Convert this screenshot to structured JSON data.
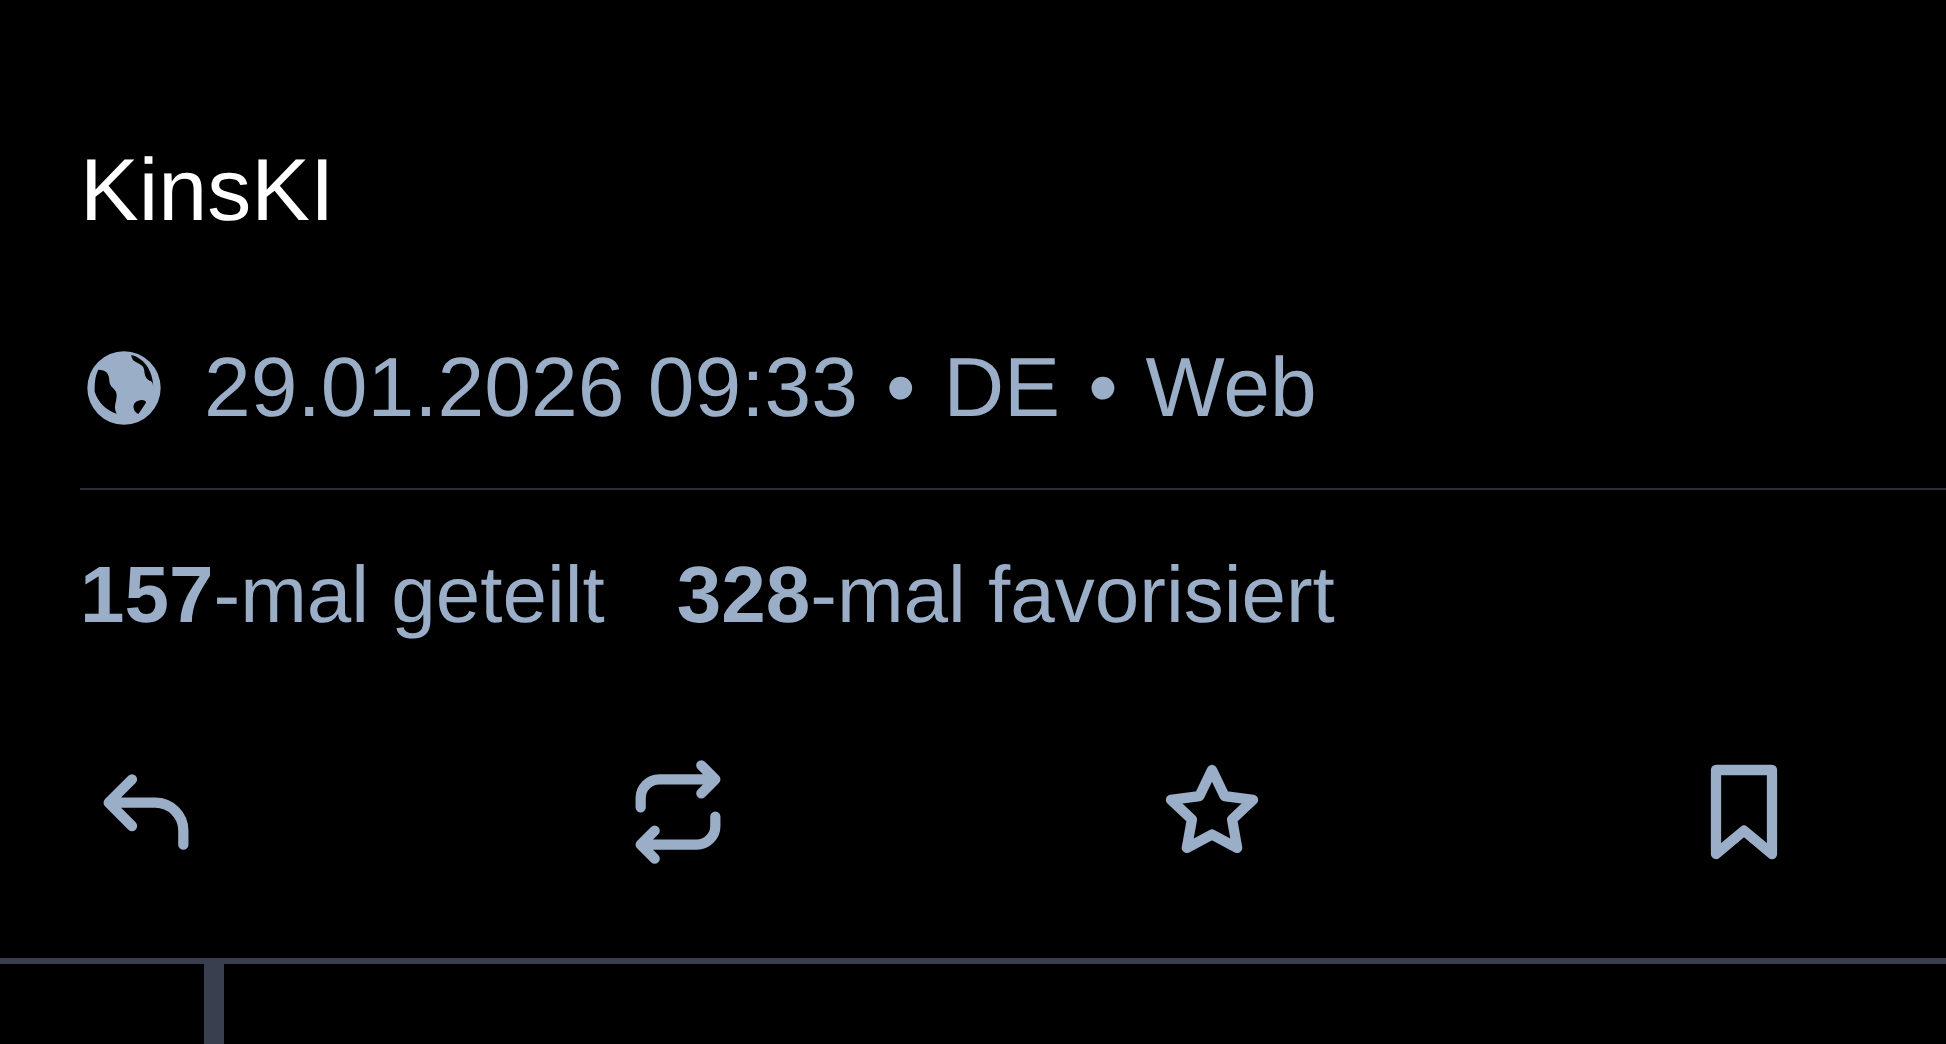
{
  "post": {
    "author": "KinsKI",
    "timestamp": "29.01.2026 09:33",
    "language": "DE",
    "source": "Web",
    "separator": "•"
  },
  "stats": [
    "**157**-mal geteilt",
    "**328**-mal favorisiert"
  ],
  "actions": [
    {
      "kind": "reply"
    },
    {
      "kind": "boost"
    },
    {
      "kind": "favourite"
    },
    {
      "kind": "bookmark"
    }
  ]
}
